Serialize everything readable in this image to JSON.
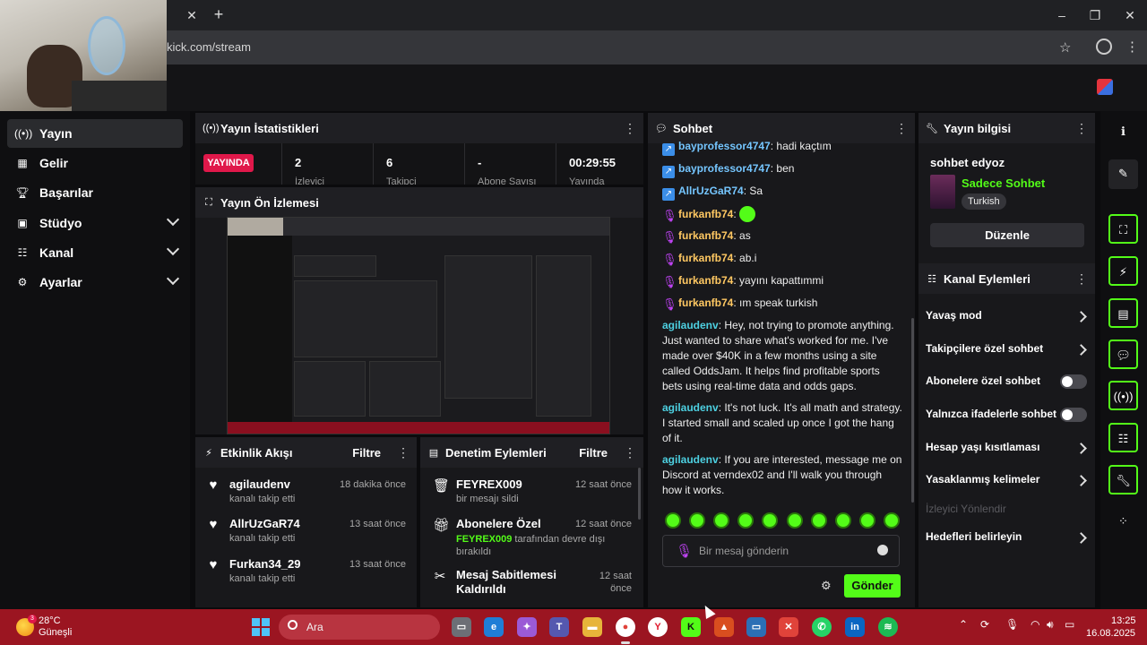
{
  "browser": {
    "url": "kick.com/stream",
    "tab_close": "✕",
    "tab_new": "+"
  },
  "sidebar": {
    "items": [
      {
        "label": "Yayın",
        "icon": "broadcast-icon",
        "active": true
      },
      {
        "label": "Gelir",
        "icon": "chart-icon"
      },
      {
        "label": "Başarılar",
        "icon": "trophy-icon"
      },
      {
        "label": "Stüdyo",
        "icon": "studio-icon",
        "expandable": true
      },
      {
        "label": "Kanal",
        "icon": "channel-icon",
        "expandable": true
      },
      {
        "label": "Ayarlar",
        "icon": "gear-icon",
        "expandable": true
      }
    ]
  },
  "stats": {
    "title": "Yayın İstatistikleri",
    "live_badge": "YAYINDA",
    "cells": [
      {
        "value": "2",
        "label": "İzleyici"
      },
      {
        "value": "6",
        "label": "Takipçi"
      },
      {
        "value": "-",
        "label": "Abone Sayısı"
      },
      {
        "value": "00:29:55",
        "label": "Yayında"
      }
    ]
  },
  "preview": {
    "title": "Yayın Ön İzlemesi"
  },
  "activity": {
    "title": "Etkinlik Akışı",
    "filter": "Filtre",
    "items": [
      {
        "name": "agilaudenv",
        "sub": "kanalı takip etti",
        "time": "18 dakika önce"
      },
      {
        "name": "AllrUzGaR74",
        "sub": "kanalı takip etti",
        "time": "13 saat önce"
      },
      {
        "name": "Furkan34_29",
        "sub": "kanalı takip etti",
        "time": "13 saat önce"
      }
    ]
  },
  "moderation": {
    "title": "Denetim Eylemleri",
    "filter": "Filtre",
    "items": [
      {
        "name": "FEYREX009",
        "sub": "bir mesajı sildi",
        "time": "12 saat önce"
      },
      {
        "name": "Abonelere Özel",
        "sub_user": "FEYREX009",
        "sub": " tarafından devre dışı bırakıldı",
        "time": "12 saat önce"
      },
      {
        "name": "Mesaj Sabitlemesi Kaldırıldı",
        "time": "12 saat önce"
      }
    ]
  },
  "chat": {
    "title": "Sohbet",
    "messages": [
      {
        "user": "bayprofessor4747",
        "text": "hadi kaçtım"
      },
      {
        "user": "bayprofessor4747",
        "text": "ben"
      },
      {
        "user": "AllrUzGaR74",
        "text": "Sa"
      },
      {
        "user": "furkanfb74",
        "text": ""
      },
      {
        "user": "furkanfb74",
        "text": "as"
      },
      {
        "user": "furkanfb74",
        "text": "ab.i"
      },
      {
        "user": "furkanfb74",
        "text": "yayını kapattımmi"
      },
      {
        "user": "furkanfb74",
        "text": "ım speak turkish"
      },
      {
        "user": "agilaudenv",
        "text": "Hey, not trying to promote anything. Just wanted to share what's worked for me. I've made over $40K in a few months using a site called OddsJam. It helps find profitable sports bets using real-time data and odds gaps."
      },
      {
        "user": "agilaudenv",
        "text": "It's not luck. It's all math and strategy. I started small and scaled up once I got the hang of it."
      },
      {
        "user": "agilaudenv",
        "text": "If you are interested, message me on Discord at verndex02 and I'll walk you through how it works."
      }
    ],
    "input_placeholder": "Bir mesaj gönderin",
    "send_label": "Gönder"
  },
  "stream_info": {
    "title": "Yayın bilgisi",
    "stream_title": "sohbet edyoz",
    "category": "Sadece Sohbet",
    "tag": "Turkish",
    "edit_label": "Düzenle"
  },
  "channel_actions": {
    "title": "Kanal Eylemleri",
    "items": [
      {
        "label": "Yavaş mod",
        "control": "chevron"
      },
      {
        "label": "Takipçilere özel sohbet",
        "control": "chevron"
      },
      {
        "label": "Abonelere özel sohbet",
        "control": "toggle"
      },
      {
        "label": "Yalnızca ifadelerle sohbet",
        "control": "toggle"
      },
      {
        "label": "Hesap yaşı kısıtlaması",
        "control": "chevron"
      },
      {
        "label": "Yasaklanmış kelimeler",
        "control": "chevron"
      },
      {
        "label": "İzleyici Yönlendir",
        "control": "none",
        "disabled": true
      },
      {
        "label": "Hedefleri belirleyin",
        "control": "chevron"
      }
    ]
  },
  "taskbar": {
    "weather_temp": "28°C",
    "weather_desc": "Güneşli",
    "weather_badge": "3",
    "search_placeholder": "Ara",
    "time": "13:25",
    "date": "16.08.2025"
  },
  "colors": {
    "accent": "#53fc18",
    "live": "#e0184a",
    "taskbar": "#9b1521"
  }
}
